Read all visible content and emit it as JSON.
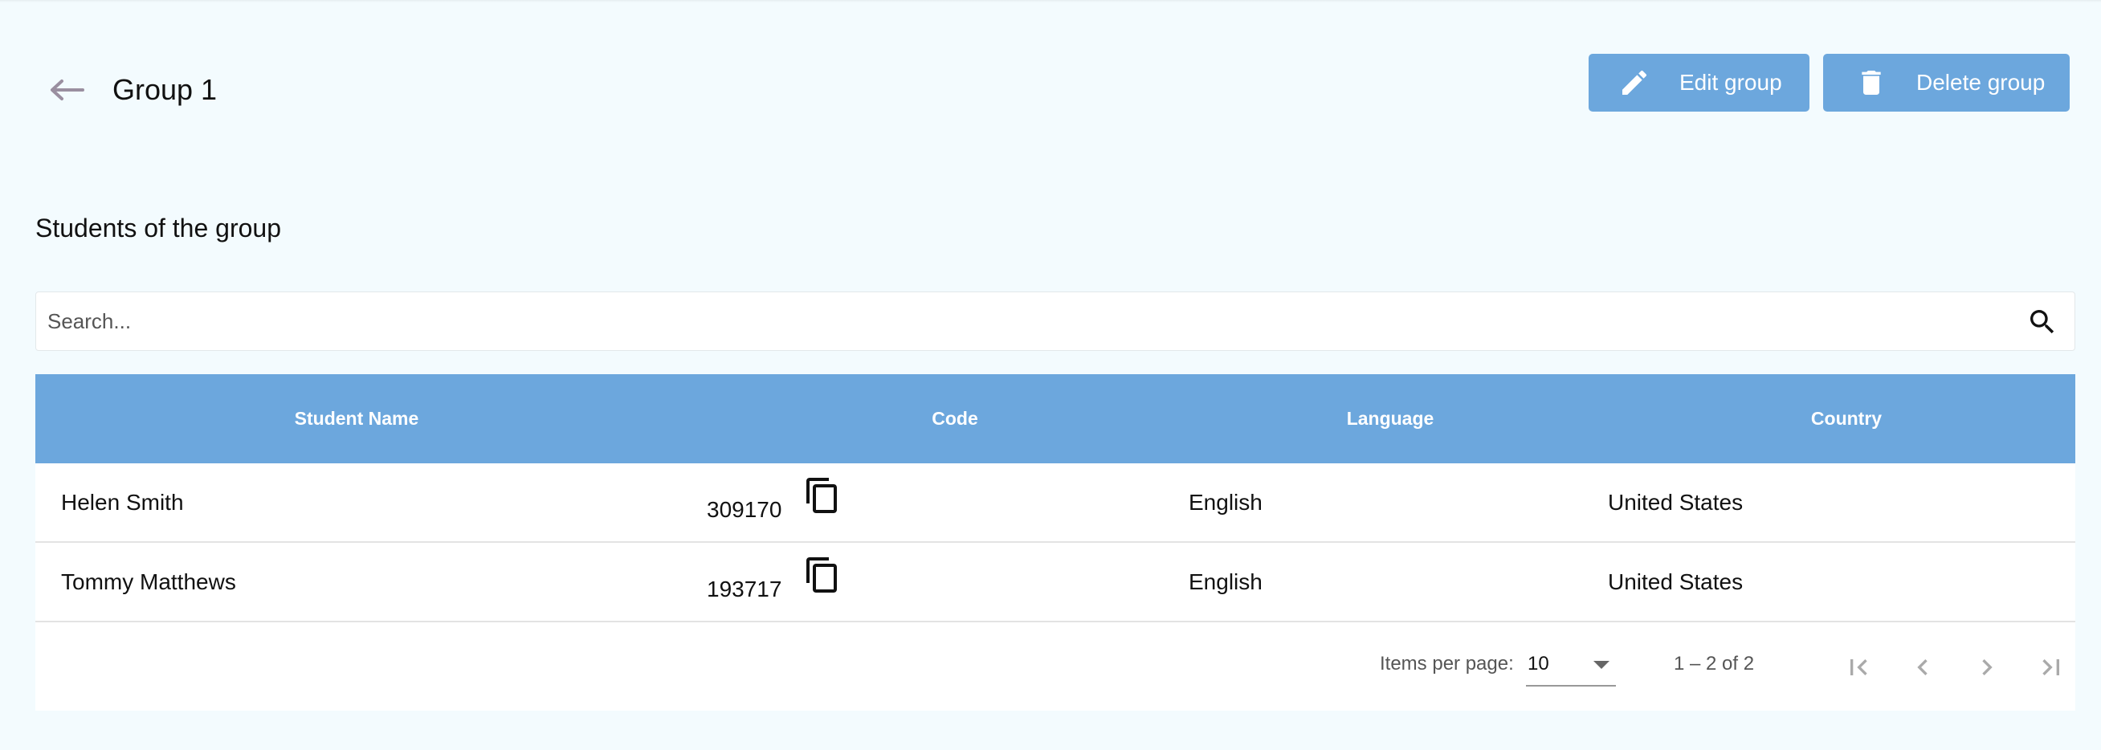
{
  "header": {
    "title": "Group 1",
    "back_icon": "arrow-back-icon",
    "edit_label": "Edit group",
    "delete_label": "Delete group"
  },
  "section_title": "Students of the group",
  "search": {
    "placeholder": "Search...",
    "value": ""
  },
  "table": {
    "columns": [
      "Student Name",
      "Code",
      "Language",
      "Country"
    ],
    "rows": [
      {
        "name": "Helen Smith",
        "code": "309170",
        "language": "English",
        "country": "United States"
      },
      {
        "name": "Tommy Matthews",
        "code": "193717",
        "language": "English",
        "country": "United States"
      }
    ]
  },
  "paginator": {
    "items_per_page_label": "Items per page:",
    "items_per_page": "10",
    "range": "1 – 2 of 2"
  },
  "colors": {
    "accent": "#6ca7dd",
    "background": "#f3fbfe"
  }
}
